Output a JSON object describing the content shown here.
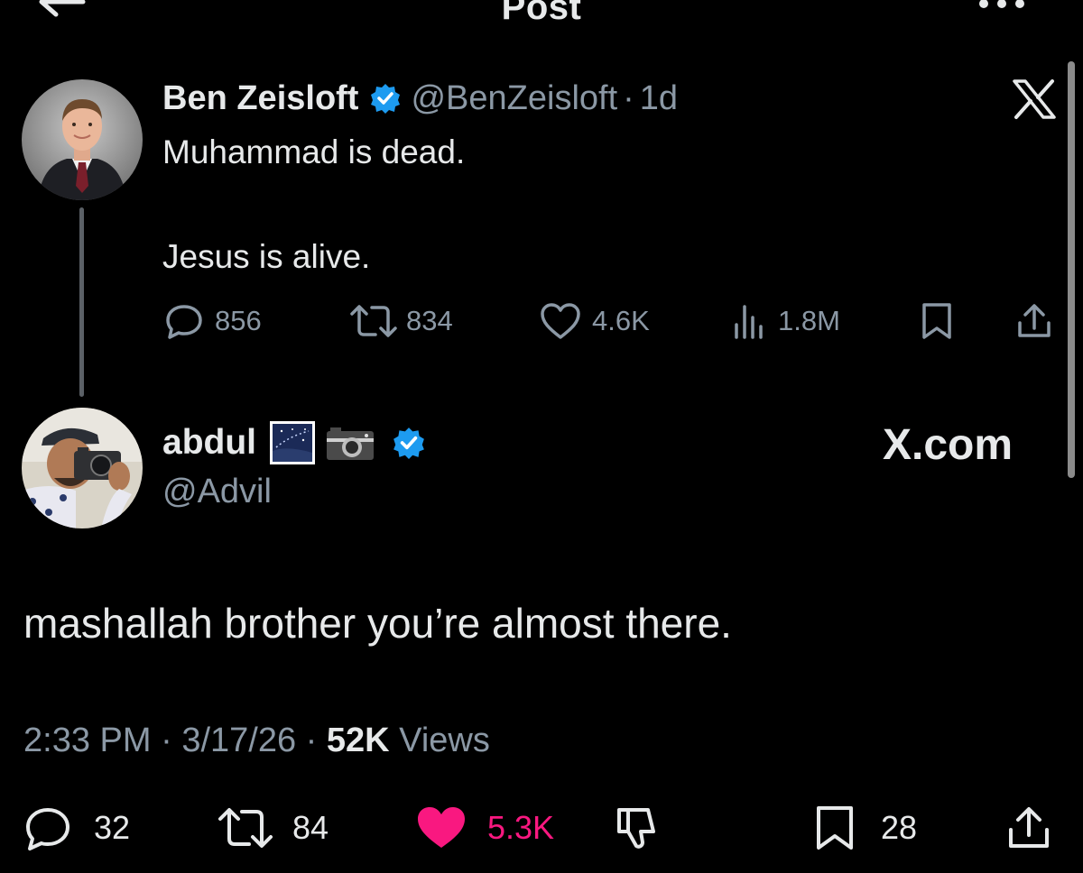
{
  "header": {
    "title": "Post"
  },
  "parent_tweet": {
    "display_name": "Ben Zeisloft",
    "handle": "@BenZeisloft",
    "separator": "·",
    "time": "1d",
    "body_line1": "Muhammad is dead.",
    "body_line2": "Jesus is alive.",
    "stats": {
      "replies": "856",
      "reposts": "834",
      "likes": "4.6K",
      "views": "1.8M"
    }
  },
  "reply_tweet": {
    "display_name": "abdul",
    "handle": "@Advil",
    "source_label": "X.com",
    "body": "mashallah brother you’re almost there.",
    "meta": {
      "time": "2:33 PM",
      "separator": "·",
      "date": "3/17/26",
      "views_count": "52K",
      "views_label": "Views"
    },
    "stats": {
      "replies": "32",
      "reposts": "84",
      "likes": "5.3K",
      "bookmarks": "28"
    }
  },
  "colors": {
    "background": "#000000",
    "text_primary": "#e7e9ea",
    "text_secondary": "#8b98a5",
    "verified_blue": "#1d9bf0",
    "like_pink": "#f91880"
  },
  "icons": [
    "back-arrow-icon",
    "more-dots-icon",
    "verified-badge-icon",
    "x-logo-icon",
    "reply-icon",
    "repost-icon",
    "like-icon",
    "views-icon",
    "bookmark-icon",
    "share-icon",
    "dislike-icon",
    "starry-night-emoji-icon",
    "camera-emoji-icon"
  ]
}
